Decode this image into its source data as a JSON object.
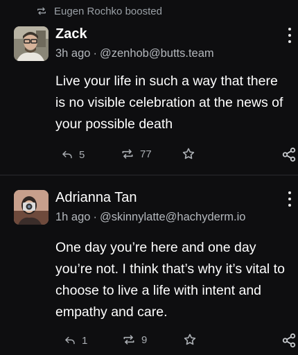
{
  "boost": {
    "text": "Eugen Rochko boosted",
    "icon": "boost-icon"
  },
  "posts": [
    {
      "display_name": "Zack",
      "time": "3h ago",
      "handle": "@zenhob@butts.team",
      "content": "Live your life in such a way that there is no visible celebration at the news of your possible death",
      "replies": "5",
      "boosts": "77"
    },
    {
      "display_name": "Adrianna Tan",
      "time": "1h ago",
      "handle": "@skinnylatte@hachyderm.io",
      "content": "One day you’re here and one day you’re not. I think that’s why it’s vital to choose to live a life with intent and empathy and care.",
      "replies": "1",
      "boosts": "9"
    }
  ],
  "separator": "·",
  "colors": {
    "background": "#0e0e10",
    "text": "#ffffff",
    "muted": "#9aa0a6"
  }
}
